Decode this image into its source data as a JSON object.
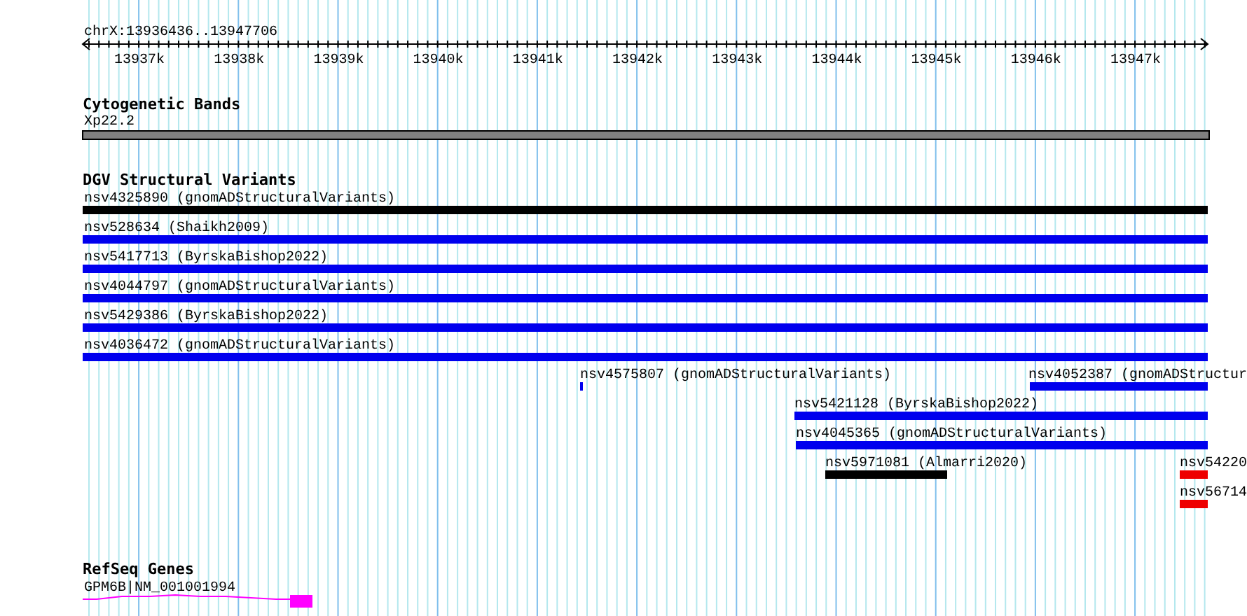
{
  "ruler": {
    "location": "chrX:13936436..13947706",
    "ticks": [
      "13937k",
      "13938k",
      "13939k",
      "13940k",
      "13941k",
      "13942k",
      "13943k",
      "13944k",
      "13945k",
      "13946k",
      "13947k"
    ]
  },
  "tracks": [
    {
      "title": "Cytogenetic Bands",
      "kind": "bands",
      "features": [
        {
          "label": "Xp22.2"
        }
      ]
    },
    {
      "title": "DGV Structural Variants",
      "kind": "variants",
      "features": [
        {
          "label": "nsv4325890 (gnomADStructuralVariants)",
          "color": "#000000"
        },
        {
          "label": "nsv528634 (Shaikh2009)",
          "color": "#0000ee"
        },
        {
          "label": "nsv5417713 (ByrskaBishop2022)",
          "color": "#0000ee"
        },
        {
          "label": "nsv4044797 (gnomADStructuralVariants)",
          "color": "#0000ee"
        },
        {
          "label": "nsv5429386 (ByrskaBishop2022)",
          "color": "#0000ee"
        },
        {
          "label": "nsv4036472 (gnomADStructuralVariants)",
          "color": "#0000ee"
        },
        {
          "label": "nsv4575807 (gnomADStructuralVariants)",
          "color": "#0000ee"
        },
        {
          "label": "nsv4052387 (gnomADStructur",
          "color": "#0000ee"
        },
        {
          "label": "nsv5421128 (ByrskaBishop2022)",
          "color": "#0000ee"
        },
        {
          "label": "nsv4045365 (gnomADStructuralVariants)",
          "color": "#0000ee"
        },
        {
          "label": "nsv5971081 (Almarri2020)",
          "color": "#000000"
        },
        {
          "label": "nsv54220",
          "color": "#ee0000"
        },
        {
          "label": "nsv56714",
          "color": "#ee0000"
        }
      ]
    },
    {
      "title": "RefSeq Genes",
      "kind": "genes",
      "features": [
        {
          "label": "GPM6B|NM_001001994"
        }
      ]
    }
  ]
}
